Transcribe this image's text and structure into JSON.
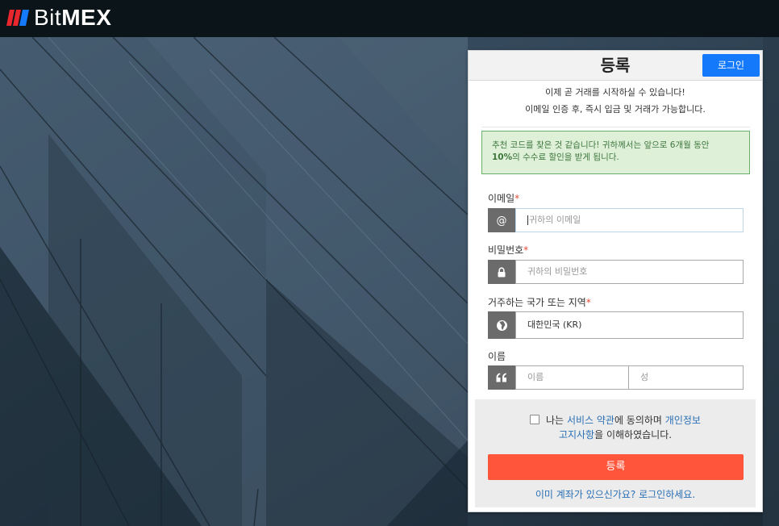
{
  "brand": {
    "logo_text_light": "Bit",
    "logo_text_bold": "MEX",
    "mark_red": "#e8262d",
    "mark_blue": "#1479fb"
  },
  "colors": {
    "topbar": "#0b1418",
    "primary_button": "#1479fb",
    "submit_button": "#ff553a",
    "link": "#2a6fb5",
    "required": "#e14b36"
  },
  "panel": {
    "title": "등록",
    "login_button": "로그인",
    "intro_line1": "이제 곧 거래를 시작하실 수 있습니다!",
    "intro_line2": "이메일 인증 후, 즉시 입금 및 거래가 가능합니다.",
    "referral_part1": "추천 코드를 찾은 것 같습니다! 귀하께서는 앞으로 6개월 동안",
    "referral_bold": "10%",
    "referral_part2": "의 수수료 할인을 받게 됩니다."
  },
  "form": {
    "email": {
      "label": "이메일",
      "required_mark": "*",
      "placeholder": "귀하의 이메일",
      "icon": "at-icon"
    },
    "password": {
      "label": "비밀번호",
      "required_mark": "*",
      "placeholder": "귀하의 비밀번호",
      "icon": "lock-icon"
    },
    "country": {
      "label": "거주하는 국가 또는 지역",
      "required_mark": "*",
      "value": "대한민국 (KR)",
      "icon": "globe-icon"
    },
    "name": {
      "label": "이름",
      "first_placeholder": "이름",
      "last_placeholder": "성",
      "icon": "quote-icon"
    }
  },
  "agreement": {
    "prefix": "나는",
    "terms_link": "서비스 약관",
    "middle": "에 동의하며",
    "privacy_link_line1": "개인정보",
    "privacy_link_line2": "고지사항",
    "suffix": "을 이해하였습니다.",
    "checked": false
  },
  "submit_label": "등록",
  "login_prompt": "이미 계좌가 있으신가요? 로그인하세요."
}
